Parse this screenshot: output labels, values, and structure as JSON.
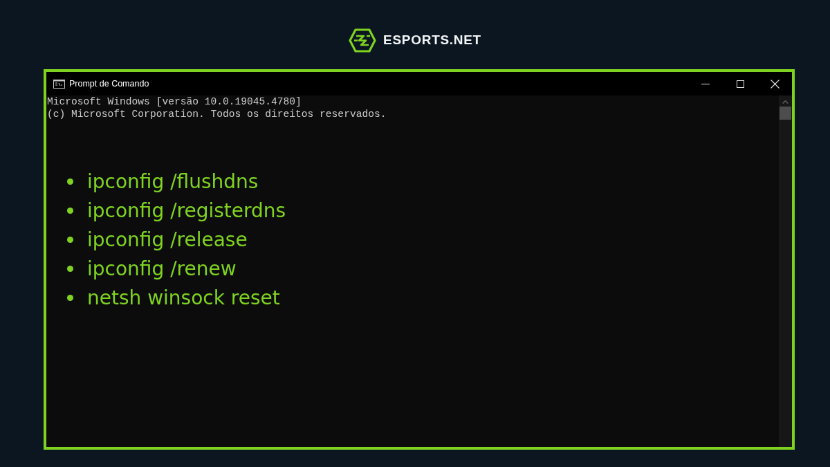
{
  "brand": {
    "name": "ESPORTS.NET"
  },
  "window": {
    "title": "Prompt de Comando",
    "lines": [
      "Microsoft Windows [versão 10.0.19045.4780]",
      "(c) Microsoft Corporation. Todos os direitos reservados."
    ]
  },
  "commands": [
    "ipconfig /flushdns",
    "ipconfig /registerdns",
    "ipconfig /release",
    "ipconfig /renew",
    "netsh winsock reset"
  ]
}
